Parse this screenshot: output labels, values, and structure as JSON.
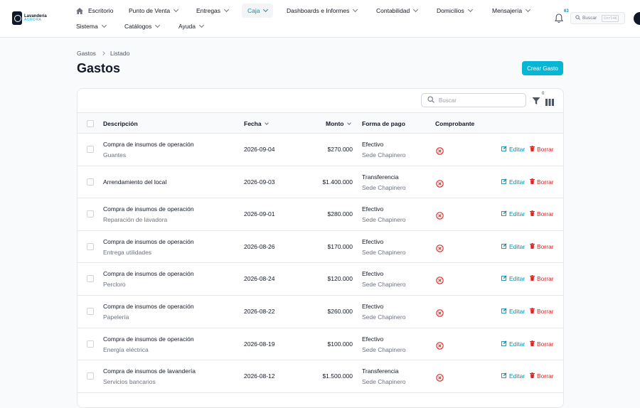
{
  "brand": {
    "name": "Lavandería",
    "tagline": "AURORA",
    "primary": "#06b6d4",
    "danger": "#dc2626"
  },
  "nav": {
    "row1": [
      {
        "label": "Escritorio",
        "icon": "home-icon"
      },
      {
        "label": "Punto de Venta"
      },
      {
        "label": "Entregas"
      },
      {
        "label": "Caja",
        "active": true
      },
      {
        "label": "Dashboards e Informes"
      },
      {
        "label": "Contabilidad"
      },
      {
        "label": "Domicilios"
      },
      {
        "label": "Mensajería"
      }
    ],
    "row2": [
      {
        "label": "Sistema"
      },
      {
        "label": "Catálogos"
      },
      {
        "label": "Ayuda"
      }
    ]
  },
  "notifications": {
    "count": "63",
    "icon": "bell-icon"
  },
  "global_search": {
    "placeholder": "Buscar",
    "shortcut": "Ctrl+K",
    "icon": "search-icon"
  },
  "breadcrumb": {
    "parent": "Gastos",
    "current": "Listado"
  },
  "page": {
    "title": "Gastos",
    "create_label": "Crear Gasto"
  },
  "table": {
    "search_placeholder": "Buscar",
    "filter_count": "0",
    "headers": {
      "description": "Descripción",
      "date": "Fecha",
      "amount": "Monto",
      "payment": "Forma de pago",
      "receipt": "Comprobante"
    },
    "edit_label": "Editar",
    "delete_label": "Borrar",
    "rows": [
      {
        "desc": "Compra de insumos de operación",
        "sub": "Guantes",
        "date": "2026-09-04",
        "amount": "$270.000",
        "payment": "Efectivo",
        "branch": "Sede Chapinero"
      },
      {
        "desc": "Arrendamiento del local",
        "sub": "",
        "date": "2026-09-03",
        "amount": "$1.400.000",
        "payment": "Transferencia",
        "branch": "Sede Chapinero"
      },
      {
        "desc": "Compra de insumos de operación",
        "sub": "Reparación de lavadora",
        "date": "2026-09-01",
        "amount": "$280.000",
        "payment": "Efectivo",
        "branch": "Sede Chapinero"
      },
      {
        "desc": "Compra de insumos de operación",
        "sub": "Entrega utilidades",
        "date": "2026-08-26",
        "amount": "$170.000",
        "payment": "Efectivo",
        "branch": "Sede Chapinero"
      },
      {
        "desc": "Compra de insumos de operación",
        "sub": "Percloro",
        "date": "2026-08-24",
        "amount": "$120.000",
        "payment": "Efectivo",
        "branch": "Sede Chapinero"
      },
      {
        "desc": "Compra de insumos de operación",
        "sub": "Papelería",
        "date": "2026-08-22",
        "amount": "$260.000",
        "payment": "Efectivo",
        "branch": "Sede Chapinero"
      },
      {
        "desc": "Compra de insumos de operación",
        "sub": "Energía eléctrica",
        "date": "2026-08-19",
        "amount": "$100.000",
        "payment": "Efectivo",
        "branch": "Sede Chapinero"
      },
      {
        "desc": "Compra de insumos de lavandería",
        "sub": "Servicios bancarios",
        "date": "2026-08-12",
        "amount": "$1.500.000",
        "payment": "Transferencia",
        "branch": "Sede Chapinero"
      }
    ]
  }
}
